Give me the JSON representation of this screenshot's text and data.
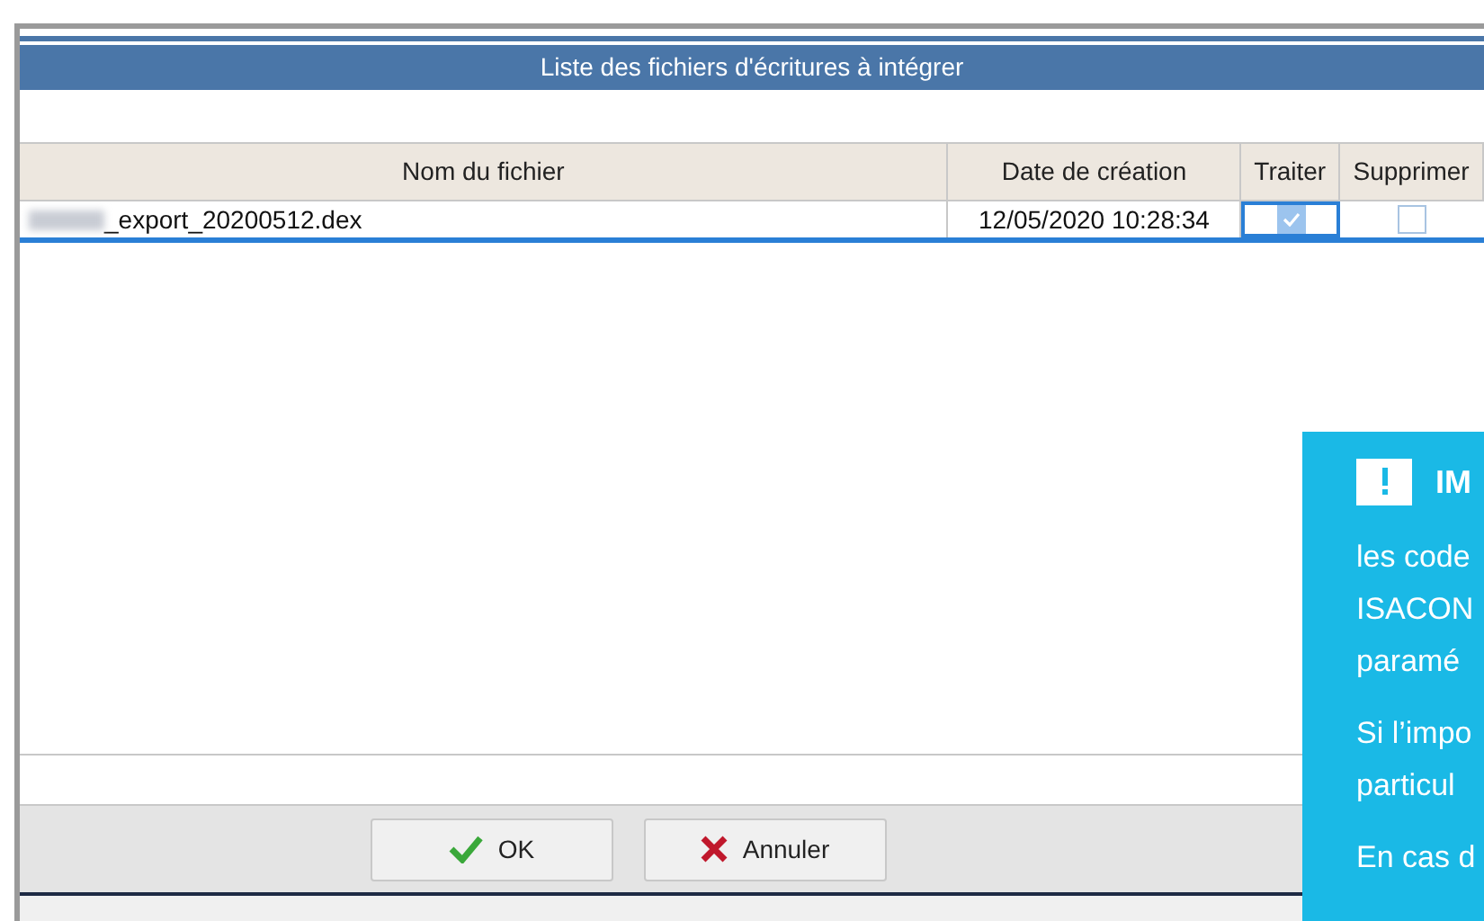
{
  "dialog": {
    "title": "Liste des fichiers d'écritures à intégrer"
  },
  "table": {
    "columns": [
      "Nom du fichier",
      "Date de création",
      "Traiter",
      "Supprimer"
    ],
    "rows": [
      {
        "file_name": "_export_20200512.dex",
        "date": "12/05/2020 10:28:34",
        "process": true,
        "delete": false,
        "selected": true
      }
    ]
  },
  "buttons": [
    {
      "kind": "ok",
      "label": "OK"
    },
    {
      "kind": "cancel",
      "label": "Annuler"
    }
  ],
  "notice": {
    "title": "IM",
    "paragraphs": [
      [
        "les code",
        "ISACON",
        "paramé"
      ],
      [
        "Si l’impo",
        "particul"
      ],
      [
        "En cas d"
      ]
    ]
  }
}
